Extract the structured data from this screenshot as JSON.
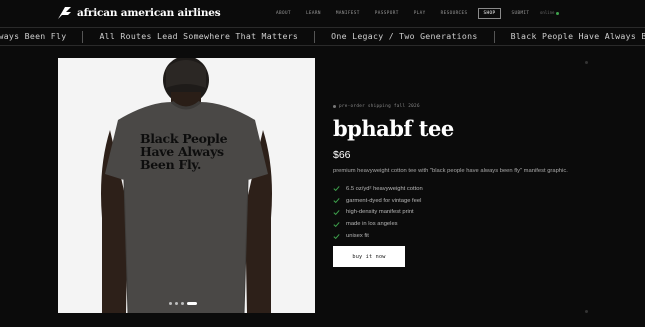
{
  "header": {
    "logo_text": "african american airlines",
    "logo_icon": "plane-wing-icon",
    "nav": [
      {
        "label": "ABOUT",
        "active": false
      },
      {
        "label": "LEARN",
        "active": false
      },
      {
        "label": "MANIFEST",
        "active": false
      },
      {
        "label": "PASSPORT",
        "active": false
      },
      {
        "label": "PLAY",
        "active": false
      },
      {
        "label": "RESOURCES",
        "active": false
      },
      {
        "label": "SHOP",
        "active": true
      },
      {
        "label": "SUBMIT",
        "active": false
      }
    ]
  },
  "ticker": {
    "items": [
      "Always Been Fly",
      "All Routes Lead Somewhere That Matters",
      "One Legacy / Two Generations",
      "Black People Have Always Been Fly",
      "All Routes Lead Somewhere That Matters"
    ]
  },
  "product": {
    "image_text": "Black People Have Always Been Fly.",
    "image_count": 4,
    "image_active_index": 3,
    "eyebrow": "pre-order shipping fall 2026",
    "title": "bphabf tee",
    "price": "$66",
    "description": "premium heavyweight cotton tee with \"black people have always been fly\" manifest graphic.",
    "features": [
      "6.5 oz/yd² heavyweight cotton",
      "garment-dyed for vintage feel",
      "high-density manifest print",
      "made in los angeles",
      "unisex fit"
    ],
    "buy_label": "buy it now"
  },
  "colors": {
    "background": "#0b0b0b",
    "accent_check": "#3fa34d",
    "shirt": "#4a4846",
    "button": "#ffffff"
  }
}
